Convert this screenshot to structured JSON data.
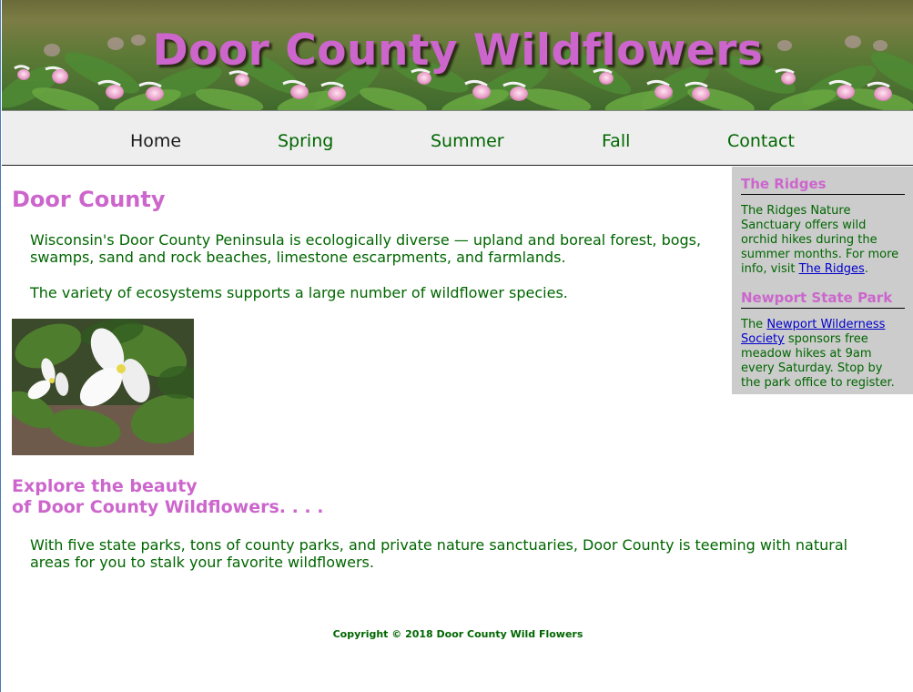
{
  "header": {
    "title": "Door County Wildflowers"
  },
  "nav": {
    "items": [
      {
        "label": "Home"
      },
      {
        "label": "Spring"
      },
      {
        "label": "Summer"
      },
      {
        "label": "Fall"
      },
      {
        "label": "Contact"
      }
    ]
  },
  "main": {
    "heading": "Door County",
    "paragraph1": "Wisconsin's Door County Peninsula is ecologically diverse — upland and boreal forest, bogs, swamps, sand and rock beaches, limestone escarpments, and farmlands.",
    "paragraph2": "The variety of ecosystems supports a large number of wildflower species.",
    "explore_line1": "Explore the beauty",
    "explore_line2": "of Door County Wildflowers. . . .",
    "paragraph3": "With five state parks, tons of county parks, and private nature sanctuaries, Door County is teeming with natural areas for you to stalk your favorite wildflowers."
  },
  "sidebar": {
    "ridges": {
      "heading": "The Ridges",
      "text_before": "The Ridges Nature Sanctuary offers wild orchid hikes during the summer months. For more info, visit ",
      "link": "The Ridges",
      "text_after": "."
    },
    "newport": {
      "heading": "Newport State Park",
      "text_before": "The ",
      "link": "Newport Wilderness Society",
      "text_after": " sponsors free meadow hikes at 9am every Saturday. Stop by the park office to register."
    }
  },
  "footer": {
    "copyright": "Copyright © 2018 Door County Wild Flowers"
  },
  "colors": {
    "heading": "#cc66cc",
    "text": "#006600",
    "nav_bg": "#eeeeee",
    "sidebar_bg": "#cccccc",
    "link": "#0000cc"
  },
  "icons": {
    "banner_image": "lady-slipper-orchids-banner",
    "photo": "white-trillium-photo"
  }
}
